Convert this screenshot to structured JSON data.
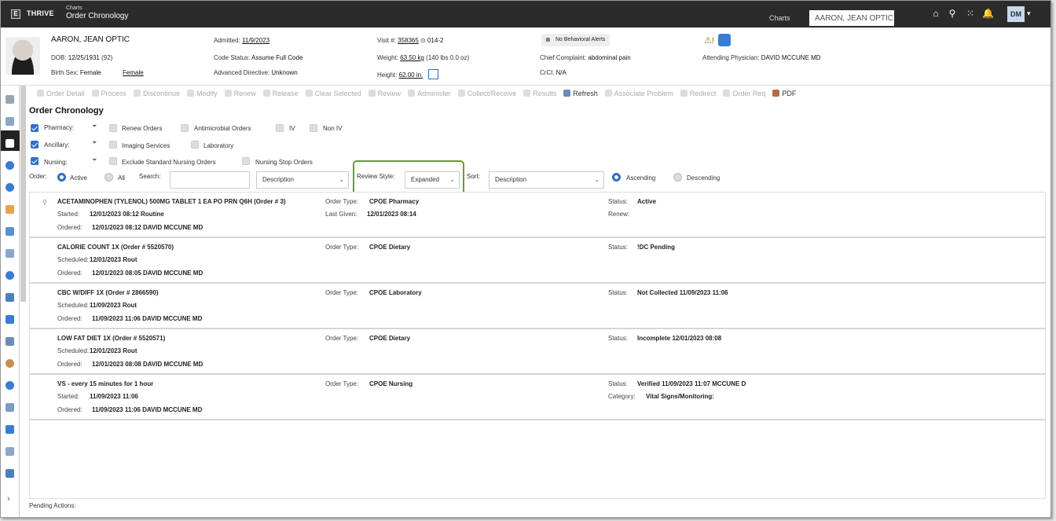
{
  "header": {
    "brand": "THRIVE",
    "section": "Charts",
    "page_title": "Order Chronology",
    "charts_link": "Charts",
    "search_value": "AARON, JEAN OPTIC",
    "user_initials": "DM"
  },
  "banner": {
    "patient_name": "AARON, JEAN OPTIC",
    "dob_label": "DOB:",
    "dob": "12/25/1931",
    "age": "(92)",
    "birth_sex_label": "Birth Sex:",
    "birth_sex": "Female",
    "gender": "Female",
    "admitted_label": "Admitted:",
    "admitted": "11/9/2023",
    "code_status_label": "Code Status:",
    "code_status": "Assume Full Code",
    "advanced_directive_label": "Advanced Directive:",
    "advanced_directive": "Unknown",
    "visit_label": "Visit #:",
    "visit": "358365",
    "room": "014-2",
    "weight_label": "Weight:",
    "weight": "63.50 kg",
    "weight_alt": "(140 lbs 0.0 oz)",
    "height_label": "Height:",
    "height": "62.00 in.",
    "alert": "No Behavioral Alerts",
    "chief_complaint_label": "Chief Complaint:",
    "chief_complaint": "abdominal pain",
    "crcl_label": "CrCl:",
    "crcl": "N/A",
    "attending_label": "Attending Physician:",
    "attending": "DAVID MCCUNE MD"
  },
  "toolbar": [
    {
      "label": "Order Detail",
      "enabled": false
    },
    {
      "label": "Process",
      "enabled": false
    },
    {
      "label": "Discontinue",
      "enabled": false
    },
    {
      "label": "Modify",
      "enabled": false
    },
    {
      "label": "Renew",
      "enabled": false
    },
    {
      "label": "Release",
      "enabled": false
    },
    {
      "label": "Clear Selected",
      "enabled": false
    },
    {
      "label": "Review",
      "enabled": false
    },
    {
      "label": "Administer",
      "enabled": false
    },
    {
      "label": "Collect/Receive",
      "enabled": false
    },
    {
      "label": "Results",
      "enabled": false
    },
    {
      "label": "Refresh",
      "enabled": true
    },
    {
      "label": "Associate Problem",
      "enabled": false
    },
    {
      "label": "Redirect",
      "enabled": false
    },
    {
      "label": "Order Req",
      "enabled": false
    },
    {
      "label": "PDF",
      "enabled": true
    }
  ],
  "main": {
    "title": "Order Chronology",
    "filters": {
      "pharmacy": "Pharmacy:",
      "renew_orders": "Renew Orders",
      "antimicrobial": "Antimicrobial Orders",
      "iv": "IV",
      "non_iv": "Non IV",
      "ancillary": "Ancillary:",
      "imaging": "Imaging Services",
      "laboratory": "Laboratory",
      "nursing": "Nursing:",
      "exclude_standard": "Exclude Standard Nursing Orders",
      "nursing_stop": "Nursing Stop Orders"
    },
    "controls": {
      "order_label": "Order:",
      "active": "Active",
      "all": "All",
      "search_label": "Search:",
      "search_value": "",
      "field_select": "Description",
      "review_style_label": "Review Style:",
      "review_style": "Expanded",
      "sort_label": "Sort:",
      "sort_select": "Description",
      "ascending": "Ascending",
      "descending": "Descending"
    },
    "orders": [
      {
        "name": "ACETAMINOPHEN (TYLENOL) 500MG TABLET 1 EA PO PRN Q6H (Order # 3)",
        "line2_label": "Started:",
        "line2": "12/01/2023 08:12 Routine",
        "ordered_label": "Ordered:",
        "ordered": "12/01/2023 08:12 DAVID MCCUNE MD",
        "type_label": "Order Type:",
        "type": "CPOE Pharmacy",
        "extra_label": "Last Given:",
        "extra": "12/01/2023 08:14",
        "status_label": "Status:",
        "status": "Active",
        "status2_label": "Renew:",
        "status2": ""
      },
      {
        "name": "CALORIE COUNT 1X (Order # 5520570)",
        "line2_label": "Scheduled:",
        "line2": "12/01/2023 Rout",
        "ordered_label": "Ordered:",
        "ordered": "12/01/2023 08:05 DAVID MCCUNE MD",
        "type_label": "Order Type:",
        "type": "CPOE Dietary",
        "extra_label": "",
        "extra": "",
        "status_label": "Status:",
        "status": "!DC Pending",
        "status2_label": "",
        "status2": ""
      },
      {
        "name": "CBC W/DIFF 1X (Order # 2866590)",
        "line2_label": "Scheduled:",
        "line2": "11/09/2023 Rout",
        "ordered_label": "Ordered:",
        "ordered": "11/09/2023 11:06 DAVID MCCUNE MD",
        "type_label": "Order Type:",
        "type": "CPOE Laboratory",
        "extra_label": "",
        "extra": "",
        "status_label": "Status:",
        "status": "Not Collected 11/09/2023 11:06",
        "status2_label": "",
        "status2": ""
      },
      {
        "name": "LOW FAT DIET 1X (Order # 5520571)",
        "line2_label": "Scheduled:",
        "line2": "12/01/2023 Rout",
        "ordered_label": "Ordered:",
        "ordered": "12/01/2023 08:08 DAVID MCCUNE MD",
        "type_label": "Order Type:",
        "type": "CPOE Dietary",
        "extra_label": "",
        "extra": "",
        "status_label": "Status:",
        "status": "Incomplete 12/01/2023 08:08",
        "status2_label": "",
        "status2": ""
      },
      {
        "name": "VS - every 15 minutes for 1 hour",
        "line2_label": "Started:",
        "line2": "11/09/2023 11:06",
        "ordered_label": "Ordered:",
        "ordered": "11/09/2023 11:06 DAVID MCCUNE MD",
        "type_label": "Order Type:",
        "type": "CPOE Nursing",
        "extra_label": "",
        "extra": "",
        "status_label": "Status:",
        "status": "Verified 11/09/2023 11:07 MCCUNE D",
        "status2_label": "Category:",
        "status2": "Vital Signs/Monitoring:"
      }
    ],
    "pending_actions": "Pending Actions:"
  },
  "colors": {
    "accent": "#2f6fc6",
    "highlight": "#6a9c2c",
    "topbar": "#2b2b2b"
  }
}
